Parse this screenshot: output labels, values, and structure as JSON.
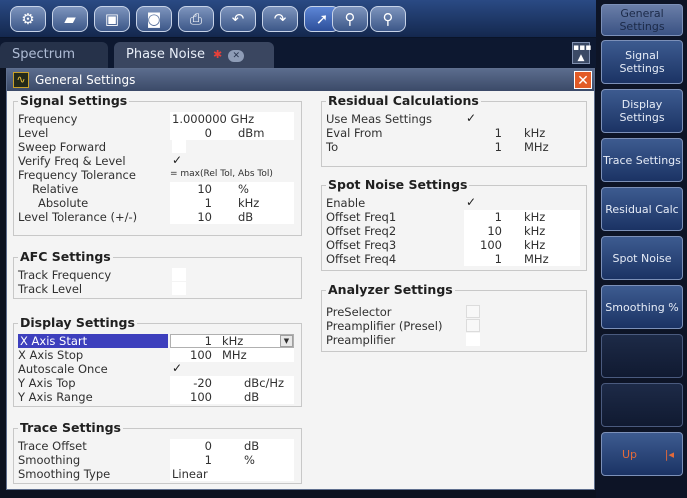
{
  "toolbar": {
    "icons": [
      "settings-icon",
      "open-folder-icon",
      "save-icon",
      "camera-icon",
      "print-icon",
      "undo-icon",
      "redo-icon",
      "pointer-icon",
      "zoom-icon",
      "multi-zoom-icon"
    ]
  },
  "tabs": [
    {
      "label": "Spectrum"
    },
    {
      "label": "Phase Noise"
    }
  ],
  "dialog": {
    "title": "General Settings"
  },
  "signal_settings": {
    "title": "Signal Settings",
    "frequency": {
      "label": "Frequency",
      "value": "1.000000 GHz"
    },
    "level": {
      "label": "Level",
      "value": "0",
      "unit": "dBm"
    },
    "sweep_forward": {
      "label": "Sweep Forward",
      "check": ""
    },
    "verify": {
      "label": "Verify Freq & Level",
      "check": "✓"
    },
    "freq_tol": {
      "label": "Frequency Tolerance",
      "value": "= max(Rel Tol, Abs Tol)"
    },
    "relative": {
      "label": "Relative",
      "value": "10",
      "unit": "%"
    },
    "absolute": {
      "label": "Absolute",
      "value": "1",
      "unit": "kHz"
    },
    "level_tol": {
      "label": "Level Tolerance (+/-)",
      "value": "10",
      "unit": "dB"
    }
  },
  "afc_settings": {
    "title": "AFC Settings",
    "track_freq": {
      "label": "Track Frequency"
    },
    "track_level": {
      "label": "Track Level"
    }
  },
  "display_settings": {
    "title": "Display Settings",
    "x_start": {
      "label": "X Axis Start",
      "value": "1",
      "unit": "kHz"
    },
    "x_stop": {
      "label": "X Axis Stop",
      "value": "100",
      "unit": "MHz"
    },
    "autoscale": {
      "label": "Autoscale Once",
      "check": "✓"
    },
    "y_top": {
      "label": "Y Axis Top",
      "value": "-20",
      "unit": "dBc/Hz"
    },
    "y_range": {
      "label": "Y Axis Range",
      "value": "100",
      "unit": "dB"
    }
  },
  "trace_settings": {
    "title": "Trace Settings",
    "offset": {
      "label": "Trace Offset",
      "value": "0",
      "unit": "dB"
    },
    "smoothing": {
      "label": "Smoothing",
      "value": "1",
      "unit": "%"
    },
    "smoothing_type": {
      "label": "Smoothing Type",
      "value": "Linear"
    }
  },
  "residual": {
    "title": "Residual Calculations",
    "use_meas": {
      "label": "Use Meas Settings",
      "check": "✓"
    },
    "eval_from": {
      "label": "Eval From",
      "value": "1",
      "unit": "kHz"
    },
    "to": {
      "label": "To",
      "value": "1",
      "unit": "MHz"
    }
  },
  "spot_noise": {
    "title": "Spot Noise Settings",
    "enable": {
      "label": "Enable",
      "check": "✓"
    },
    "f1": {
      "label": "Offset Freq1",
      "value": "1",
      "unit": "kHz"
    },
    "f2": {
      "label": "Offset Freq2",
      "value": "10",
      "unit": "kHz"
    },
    "f3": {
      "label": "Offset Freq3",
      "value": "100",
      "unit": "kHz"
    },
    "f4": {
      "label": "Offset Freq4",
      "value": "1",
      "unit": "MHz"
    }
  },
  "analyzer": {
    "title": "Analyzer Settings",
    "preselector": {
      "label": "PreSelector"
    },
    "preamp_presel": {
      "label": "Preamplifier (Presel)"
    },
    "preamp": {
      "label": "Preamplifier"
    }
  },
  "softkeys": {
    "general": "General Settings",
    "signal": "Signal Settings",
    "display": "Display Settings",
    "trace": "Trace Settings",
    "residual": "Residual Calc",
    "spot": "Spot Noise",
    "smoothing": "Smoothing %",
    "up": "Up"
  }
}
